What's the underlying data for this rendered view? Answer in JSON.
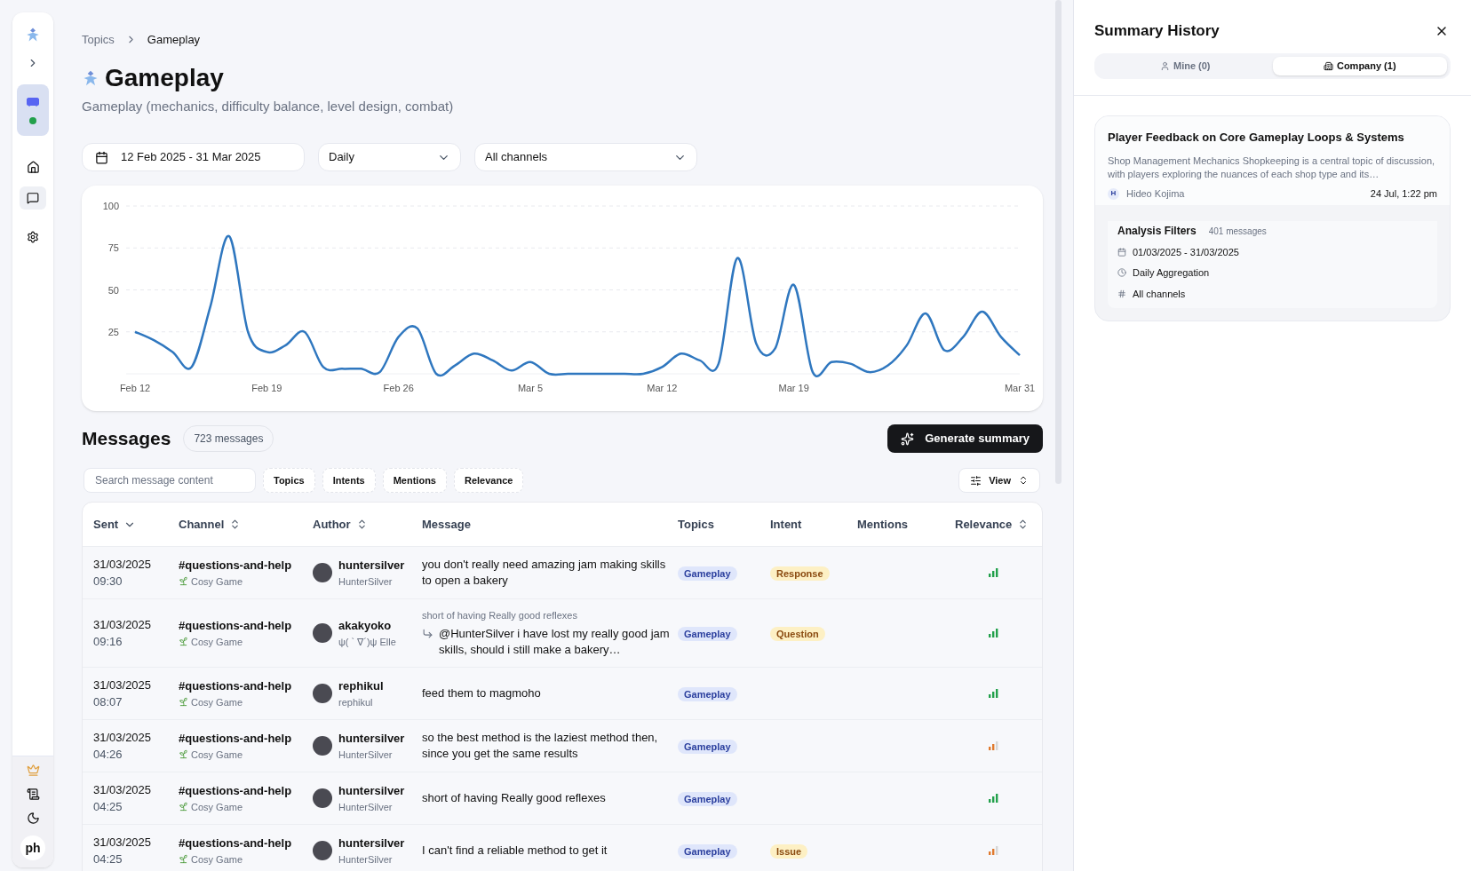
{
  "sidebar": {
    "status_online": true,
    "avatar_text": "ph"
  },
  "breadcrumb": [
    "Topics",
    "Gameplay"
  ],
  "page": {
    "title": "Gameplay",
    "subtitle": "Gameplay (mechanics, difficulty balance, level design, combat)"
  },
  "filters": {
    "date_range": "12 Feb 2025 - 31 Mar 2025",
    "aggregation": "Daily",
    "channels": "All channels"
  },
  "chart_data": {
    "type": "line",
    "categories": [
      "Feb 12",
      null,
      null,
      null,
      null,
      null,
      null,
      "Feb 19",
      null,
      null,
      null,
      null,
      null,
      null,
      "Feb 26",
      null,
      null,
      null,
      null,
      null,
      null,
      "Mar 5",
      null,
      null,
      null,
      null,
      null,
      null,
      "Mar 12",
      null,
      null,
      null,
      null,
      null,
      null,
      "Mar 19",
      null,
      null,
      null,
      null,
      null,
      null,
      null,
      null,
      null,
      null,
      null,
      "Mar 31"
    ],
    "grid": true,
    "ylim": [
      0,
      100
    ],
    "series": [
      {
        "color": "#2f77bf",
        "values": [
          25,
          20,
          13,
          4,
          40,
          82,
          25,
          13,
          17,
          25,
          4,
          3,
          3,
          1,
          22,
          27,
          0,
          5,
          12,
          8,
          2,
          7,
          0,
          0,
          0,
          0,
          0,
          0,
          4,
          12,
          8,
          6,
          69,
          18,
          15,
          53,
          1,
          7,
          6,
          1,
          5,
          17,
          36,
          14,
          22,
          37,
          22,
          11
        ]
      }
    ],
    "yticks": [
      25,
      50,
      75,
      100
    ]
  },
  "messages": {
    "title": "Messages",
    "count": "723 messages",
    "generate_button": "Generate summary",
    "search_placeholder": "Search message content",
    "filter_chips": [
      "Topics",
      "Intents",
      "Mentions",
      "Relevance"
    ],
    "view_button": "View"
  },
  "table": {
    "columns": [
      {
        "label": "Sent",
        "sorted": true
      },
      {
        "label": "Channel",
        "sorted": false
      },
      {
        "label": "Author",
        "sorted": false
      },
      {
        "label": "Message"
      },
      {
        "label": "Topics"
      },
      {
        "label": "Intent"
      },
      {
        "label": "Mentions"
      },
      {
        "label": "Relevance",
        "sorted": false
      }
    ],
    "rows": [
      {
        "date": "31/03/2025",
        "time": "09:30",
        "channel": "#questions-and-help",
        "server": "Cosy Game",
        "author": "huntersilver",
        "handle": "HunterSilver",
        "message": "you don't really need amazing jam making skills to open a bakery",
        "topic": "Gameplay",
        "intent": "Response",
        "level": 1
      },
      {
        "date": "31/03/2025",
        "time": "09:16",
        "channel": "#questions-and-help",
        "server": "Cosy Game",
        "author": "akakyoko",
        "handle": "ψ( ` ∇´)ψ Elle",
        "reply_to": "short of having Really good reflexes",
        "message": "@HunterSilver i have lost my really good jam skills, should i still make a bakery…",
        "topic": "Gameplay",
        "intent": "Question",
        "level": 1
      },
      {
        "date": "31/03/2025",
        "time": "08:07",
        "channel": "#questions-and-help",
        "server": "Cosy Game",
        "author": "rephikul",
        "handle": "rephikul",
        "message": "feed them to magmoho",
        "topic": "Gameplay",
        "level": 1
      },
      {
        "date": "31/03/2025",
        "time": "04:26",
        "channel": "#questions-and-help",
        "server": "Cosy Game",
        "author": "huntersilver",
        "handle": "HunterSilver",
        "message": "so the best method is the laziest method then, since you get the same results",
        "topic": "Gameplay",
        "level": 0.67
      },
      {
        "date": "31/03/2025",
        "time": "04:25",
        "channel": "#questions-and-help",
        "server": "Cosy Game",
        "author": "huntersilver",
        "handle": "HunterSilver",
        "message": "short of having Really good reflexes",
        "topic": "Gameplay",
        "level": 1
      },
      {
        "date": "31/03/2025",
        "time": "04:25",
        "channel": "#questions-and-help",
        "server": "Cosy Game",
        "author": "huntersilver",
        "handle": "HunterSilver",
        "message": "I can't find a reliable method to get it",
        "topic": "Gameplay",
        "intent": "Issue",
        "level": 0.67
      }
    ]
  },
  "summary_panel": {
    "title": "Summary History",
    "tabs": [
      {
        "label": "Mine (0)",
        "kind": "person",
        "selected": false
      },
      {
        "label": "Company (1)",
        "kind": "building",
        "selected": true
      }
    ],
    "card": {
      "title": "Player Feedback on Core Gameplay Loops & Systems",
      "excerpt": "Shop Management Mechanics Shopkeeping is a central topic of discussion, with players exploring the nuances of each shop type and its…",
      "author_initial": "H",
      "author": "Hideo Kojima",
      "timestamp": "24 Jul, 1:22 pm",
      "filters_title": "Analysis Filters",
      "filters_count": "401 messages",
      "filter_items": [
        {
          "kind": "date",
          "text": "01/03/2025 - 31/03/2025"
        },
        {
          "kind": "time",
          "text": "Daily Aggregation"
        },
        {
          "kind": "channel",
          "text": "All channels"
        }
      ]
    }
  }
}
